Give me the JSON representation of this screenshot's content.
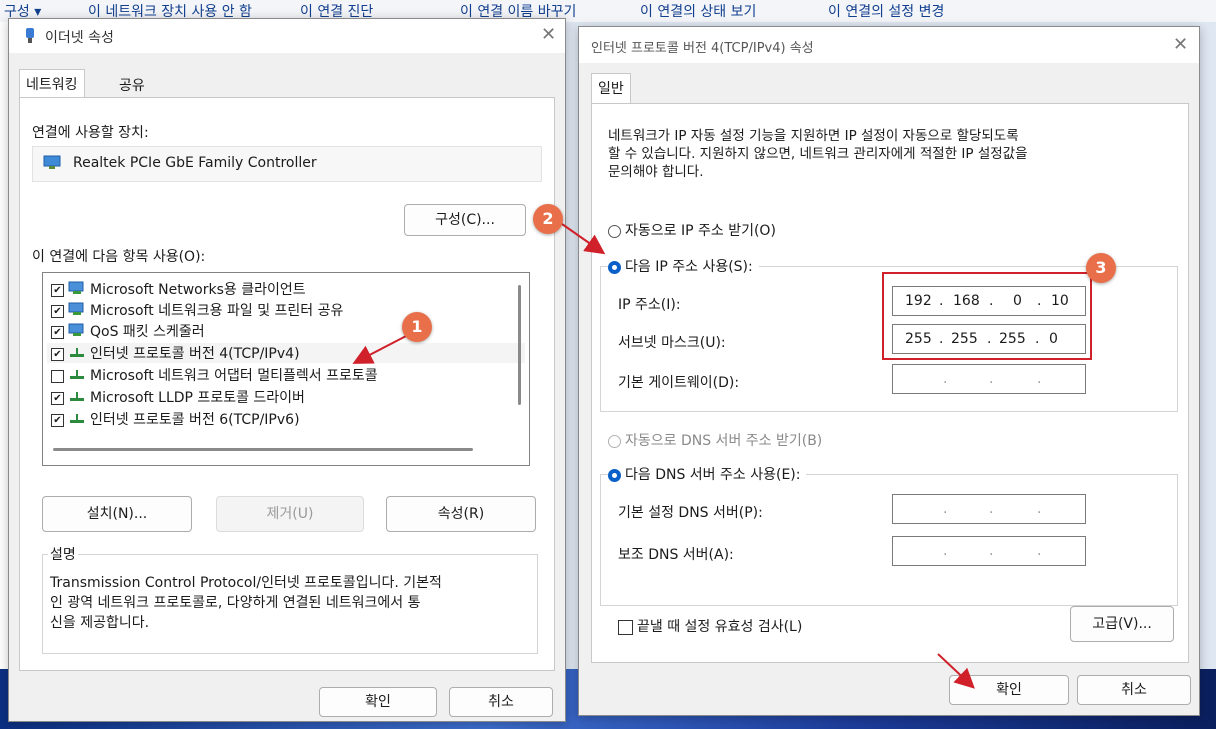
{
  "top_menu": [
    "구성 ▾",
    "이 네트워크 장치 사용 안 함",
    "이 연결 진단",
    "이 연결 이름 바꾸기",
    "이 연결의 상태 보기",
    "이 연결의 설정 변경"
  ],
  "left_window": {
    "title": "이더넷 속성",
    "tabs": [
      "네트워킹",
      "공유"
    ],
    "connect_using_label": "연결에 사용할 장치:",
    "device_name": "Realtek PCIe GbE Family Controller",
    "configure_button": "구성(C)...",
    "items_label": "이 연결에 다음 항목 사용(O):",
    "items": [
      {
        "label": "Microsoft Networks용 클라이언트",
        "checked": true
      },
      {
        "label": "Microsoft 네트워크용 파일 및 프린터 공유",
        "checked": true
      },
      {
        "label": "QoS 패킷 스케줄러",
        "checked": true
      },
      {
        "label": "인터넷 프로토콜 버전 4(TCP/IPv4)",
        "checked": true
      },
      {
        "label": "Microsoft 네트워크 어댑터 멀티플렉서 프로토콜",
        "checked": false
      },
      {
        "label": "Microsoft LLDP 프로토콜 드라이버",
        "checked": true
      },
      {
        "label": "인터넷 프로토콜 버전 6(TCP/IPv6)",
        "checked": true
      }
    ],
    "install_button": "설치(N)...",
    "remove_button": "제거(U)",
    "properties_button": "속성(R)",
    "description_label": "설명",
    "description_text": [
      "Transmission Control Protocol/인터넷 프로토콜입니다. 기본적",
      "인 광역 네트워크 프로토콜로, 다양하게 연결된 네트워크에서 통",
      "신을 제공합니다."
    ],
    "ok_button": "확인",
    "cancel_button": "취소"
  },
  "right_window": {
    "title": "인터넷 프로토콜 버전 4(TCP/IPv4) 속성",
    "tab": "일반",
    "intro": [
      "네트워크가 IP 자동 설정 기능을 지원하면 IP 설정이 자동으로 할당되도록",
      "할 수 있습니다. 지원하지 않으면, 네트워크 관리자에게 적절한 IP 설정값을",
      "문의해야 합니다."
    ],
    "auto_ip_label": "자동으로 IP 주소 받기(O)",
    "manual_ip_label": "다음 IP 주소 사용(S):",
    "ip_address_label": "IP 주소(I):",
    "ip_address": [
      "192",
      "168",
      "0",
      "10"
    ],
    "subnet_label": "서브넷 마스크(U):",
    "subnet": [
      "255",
      "255",
      "255",
      "0"
    ],
    "gateway_label": "기본 게이트웨이(D):",
    "auto_dns_label": "자동으로 DNS 서버 주소 받기(B)",
    "manual_dns_label": "다음 DNS 서버 주소 사용(E):",
    "preferred_dns_label": "기본 설정 DNS 서버(P):",
    "alternate_dns_label": "보조 DNS 서버(A):",
    "validate_label": "끝낼 때 설정 유효성 검사(L)",
    "advanced_button": "고급(V)...",
    "ok_button": "확인",
    "cancel_button": "취소"
  },
  "annotations": {
    "badge1": "1",
    "badge2": "2",
    "badge3": "3",
    "color": "#d0202a",
    "badge_color": "#e86f4a"
  }
}
